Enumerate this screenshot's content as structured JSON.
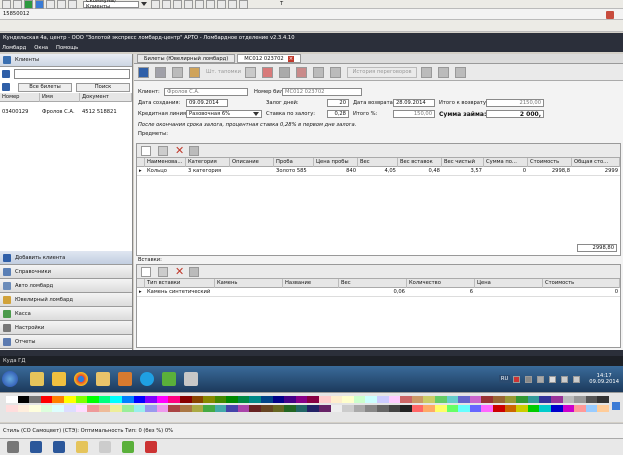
{
  "os_title_text": "15850012",
  "ide": {
    "toolbar_select": "Скоммуны/Клиенты",
    "tab_label": "Т"
  },
  "app": {
    "window_title": "Кундельская 4а, центр - ООО \"Золотой экспресс ломбард-центр\" АРТО - Ломбардное отделение v2.3.4.10",
    "menu": [
      "Ломбард",
      "Окна",
      "Помощь"
    ]
  },
  "sidebar": {
    "header": "Клиенты",
    "search_value": "",
    "all_tickets_button": "Все билеты",
    "search_button": "Поиск",
    "columns": [
      "Номер",
      "Имя",
      "Документ"
    ],
    "rows": [
      {
        "number": "03400129",
        "name": "Фролов С.А.",
        "doc": "4512 518821"
      }
    ],
    "add_client": "Добавить клиента",
    "nav": [
      "Справочники",
      "Авто ломбард",
      "Ювелирный ломбард",
      "Касса",
      "Настройки",
      "Отчеты"
    ]
  },
  "doc_tabs": [
    "Билеты (Ювелирный ломбард)",
    "MC012 023702"
  ],
  "toolbar": {
    "print_button": "Шт. тапомки",
    "extra_button": "История переговоров"
  },
  "form": {
    "client_label": "Клиент:",
    "client_value": "Фролов С.А.",
    "ticket_label": "Номер билета",
    "ticket_value": "MC012 023702",
    "created_label": "Дата создания:",
    "created_value": "09.09.2014",
    "term_label": "Залог дней:",
    "term_value": "20",
    "return_label": "Дата возврата:",
    "return_value": "28.09.2014",
    "total_return_label": "Итого к возврату:",
    "total_return_value": "2150,00",
    "credit_label": "Кредитная линия:",
    "credit_value": "Разовочная 6%",
    "bypercent_label": "Ставка по залогу:",
    "bypercent_value": "0,28",
    "itogo_label": "Итого %:",
    "itogo_value": "150,00",
    "loan_label": "Сумма займа:",
    "loan_value": "2 000,",
    "note": "После окончания срока залога, процентная ставка 0,28% в первом дне залога.",
    "items_label": "Предметы:"
  },
  "items_table": {
    "columns": [
      "",
      "Наименова...",
      "Категория",
      "Описание",
      "Проба",
      "Цена пробы",
      "Вес",
      "Вес вставок",
      "Вес чистый",
      "Сумма по...",
      "Стоимость",
      "Общая сто..."
    ],
    "rows": [
      [
        "",
        "Кольцо",
        "3 категория",
        "",
        "Золото 585",
        "840",
        "4,05",
        "0,48",
        "3,57",
        "0",
        "2998,8",
        "2999"
      ]
    ],
    "total": "2998,80"
  },
  "inserts": {
    "label": "Вставки:",
    "columns": [
      "",
      "Тип вставки",
      "Камень",
      "Название",
      "Вес",
      "Количество",
      "Цена",
      "Стоимость"
    ],
    "rows": [
      [
        "",
        "Камень синтетический",
        "",
        "",
        "0,06",
        "6",
        "",
        "0"
      ]
    ]
  },
  "bottom_bar_title": "Куда ГД",
  "taskbar": {
    "time": "14:17",
    "date": "09.09.2014",
    "lang": "RU"
  },
  "status_line": "Стиль (СО Самоцвет) (СТЭ): Оптимальность Тип: 0 (без %) 0%",
  "colors": {
    "accent_blue": "#2f5fa8",
    "title_dark": "#2b2f3a",
    "taskbar": "#1c3a5c"
  }
}
